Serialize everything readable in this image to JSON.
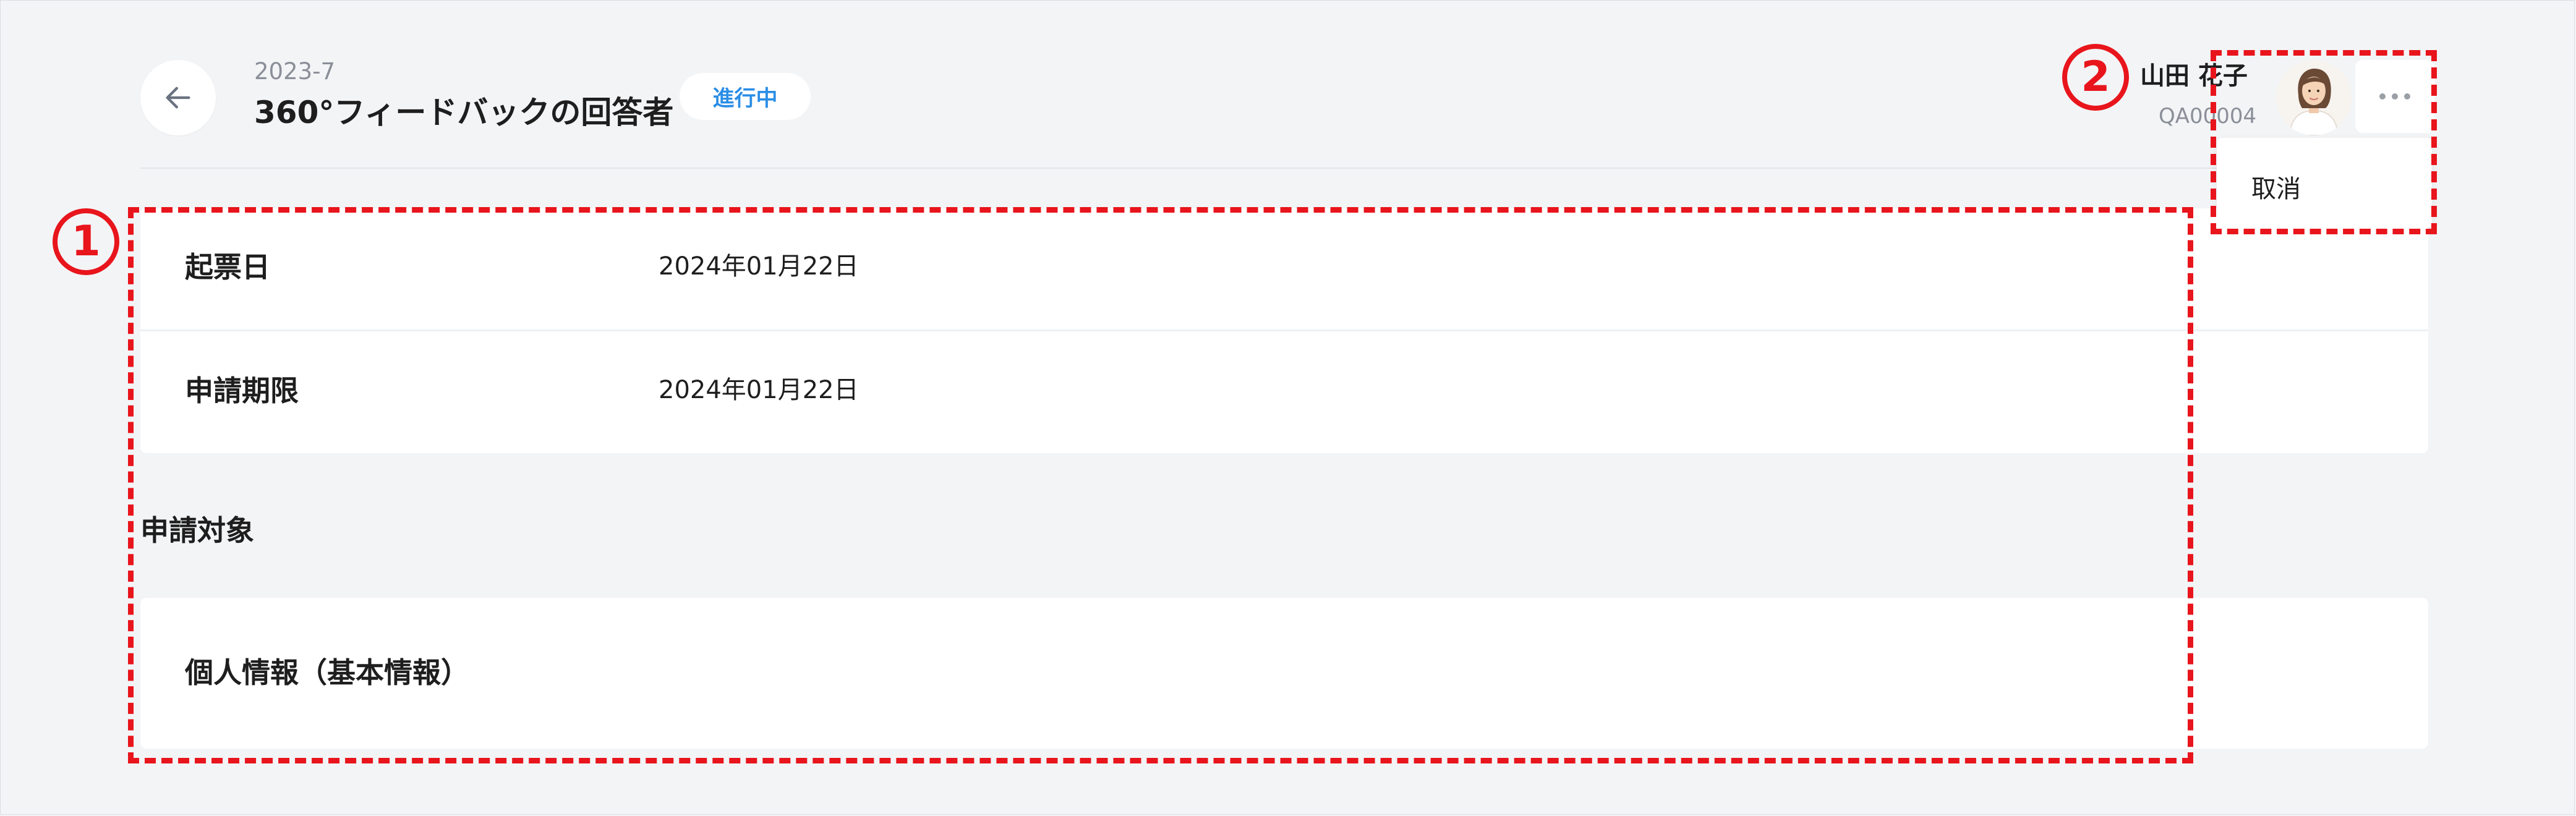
{
  "header": {
    "id": "2023-7",
    "title": "360°フィードバックの回答者",
    "status": "進行中",
    "back_icon": "arrow-left-icon"
  },
  "user": {
    "name": "山田 花子",
    "code": "QA00004",
    "more_icon": "ellipsis-horizontal-icon",
    "menu": {
      "cancel_label": "取消"
    }
  },
  "details": {
    "rows": [
      {
        "label": "起票日",
        "value": "2024年01月22日"
      },
      {
        "label": "申請期限",
        "value": "2024年01月22日"
      }
    ]
  },
  "target": {
    "section_title": "申請対象",
    "card_title": "個人情報（基本情報）"
  },
  "annotations": {
    "marker_1": "1",
    "marker_2": "2",
    "color": "#e8151c"
  },
  "colors": {
    "background": "#f3f4f6",
    "card": "#ffffff",
    "badge_text": "#2b8ee6",
    "subtle_text": "#8a8f98"
  }
}
